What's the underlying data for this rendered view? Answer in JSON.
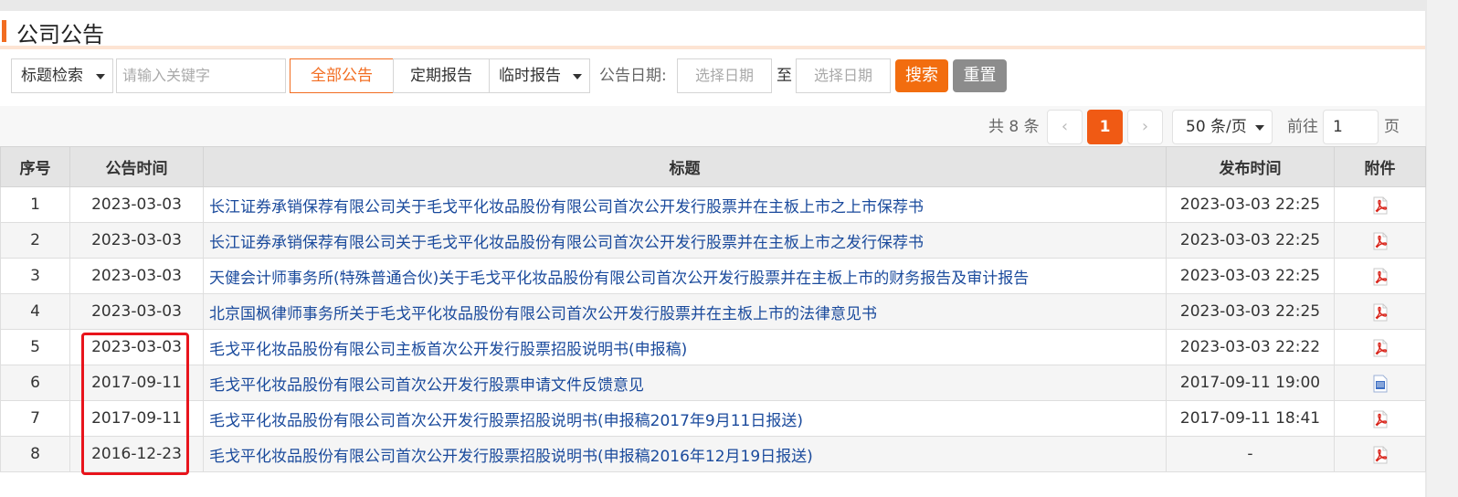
{
  "header": {
    "title": "公司公告"
  },
  "filters": {
    "search_type": "标题检索",
    "keyword_placeholder": "请输入关键字",
    "tab_all": "全部公告",
    "tab_periodic": "定期报告",
    "tab_temp": "临时报告",
    "date_label": "公告日期:",
    "date_from_placeholder": "选择日期",
    "date_to_sep": "至",
    "date_to_placeholder": "选择日期",
    "search_button": "搜索",
    "reset_button": "重置"
  },
  "pagination": {
    "total": "共 8 条",
    "current_page": "1",
    "prev": "‹",
    "next": "›",
    "page_size": "50 条/页",
    "goto_label": "前往",
    "goto_value": "1",
    "page_suffix": "页"
  },
  "table": {
    "headers": [
      "序号",
      "公告时间",
      "标题",
      "发布时间",
      "附件"
    ],
    "rows": [
      {
        "no": "1",
        "date": "2023-03-03",
        "title": "长江证券承销保荐有限公司关于毛戈平化妆品股份有限公司首次公开发行股票并在主板上市之上市保荐书",
        "published": "2023-03-03 22:25",
        "attachment": "pdf-icon"
      },
      {
        "no": "2",
        "date": "2023-03-03",
        "title": "长江证券承销保荐有限公司关于毛戈平化妆品股份有限公司首次公开发行股票并在主板上市之发行保荐书",
        "published": "2023-03-03 22:25",
        "attachment": "pdf-icon"
      },
      {
        "no": "3",
        "date": "2023-03-03",
        "title": "天健会计师事务所(特殊普通合伙)关于毛戈平化妆品股份有限公司首次公开发行股票并在主板上市的财务报告及审计报告",
        "published": "2023-03-03 22:25",
        "attachment": "pdf-icon"
      },
      {
        "no": "4",
        "date": "2023-03-03",
        "title": "北京国枫律师事务所关于毛戈平化妆品股份有限公司首次公开发行股票并在主板上市的法律意见书",
        "published": "2023-03-03 22:25",
        "attachment": "pdf-icon"
      },
      {
        "no": "5",
        "date": "2023-03-03",
        "title": "毛戈平化妆品股份有限公司主板首次公开发行股票招股说明书(申报稿)",
        "published": "2023-03-03 22:22",
        "attachment": "pdf-icon"
      },
      {
        "no": "6",
        "date": "2017-09-11",
        "title": "毛戈平化妆品股份有限公司首次公开发行股票申请文件反馈意见",
        "published": "2017-09-11 19:00",
        "attachment": "doc-icon"
      },
      {
        "no": "7",
        "date": "2017-09-11",
        "title": "毛戈平化妆品股份有限公司首次公开发行股票招股说明书(申报稿2017年9月11日报送)",
        "published": "2017-09-11 18:41",
        "attachment": "pdf-icon"
      },
      {
        "no": "8",
        "date": "2016-12-23",
        "title": "毛戈平化妆品股份有限公司首次公开发行股票招股说明书(申报稿2016年12月19日报送)",
        "published": "-",
        "attachment": "pdf-icon"
      }
    ]
  },
  "colors": {
    "accent": "#f26d21",
    "link": "#1a4a9c",
    "highlight": "#e8141c"
  }
}
